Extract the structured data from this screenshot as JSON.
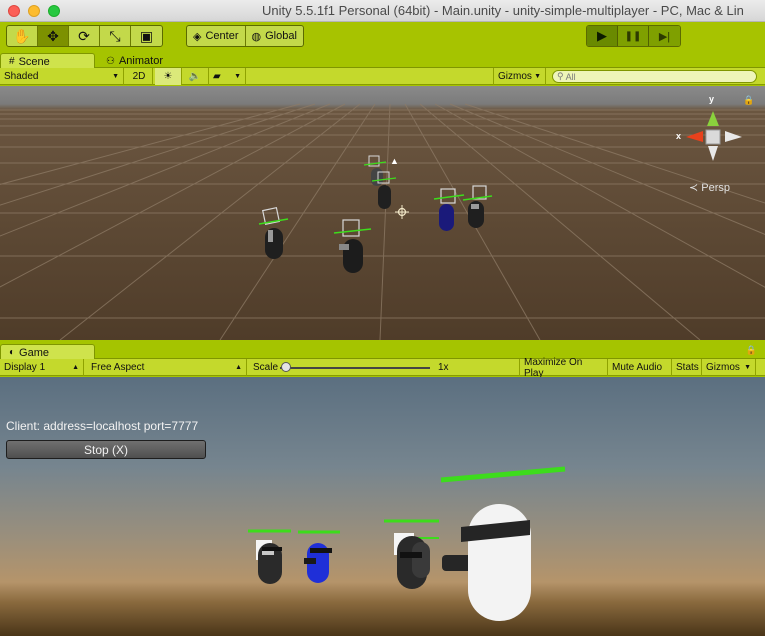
{
  "window": {
    "title": "Unity 5.5.1f1 Personal (64bit) - Main.unity - unity-simple-multiplayer - PC, Mac & Lin"
  },
  "toolbar": {
    "tools": [
      {
        "name": "hand-tool",
        "icon": "hand-icon",
        "glyph": "✋",
        "active": false
      },
      {
        "name": "move-tool",
        "icon": "move-icon",
        "glyph": "✥",
        "active": true
      },
      {
        "name": "rotate-tool",
        "icon": "rotate-icon",
        "glyph": "⟳",
        "active": false
      },
      {
        "name": "scale-tool",
        "icon": "scale-icon",
        "glyph": "⤡",
        "active": false
      },
      {
        "name": "rect-tool",
        "icon": "rect-icon",
        "glyph": "▣",
        "active": false
      }
    ],
    "pivot_label": "Center",
    "pivot_icon_glyph": "◈",
    "space_label": "Global",
    "space_icon_glyph": "◍",
    "play_glyph": "▶",
    "pause_glyph": "❚❚",
    "step_glyph": "▶|"
  },
  "scene_panel": {
    "tabs": [
      {
        "label": "Scene",
        "icon_glyph": "#",
        "active": true
      },
      {
        "label": "Animator",
        "icon_glyph": "⚇",
        "active": false
      }
    ],
    "shading_mode": "Shaded",
    "mode_2d": "2D",
    "lighting_glyph": "☀",
    "audio_glyph": "🔈",
    "effects_glyph": "▰",
    "gizmos_label": "Gizmos",
    "search_placeholder": "All",
    "search_glyph": "⚲",
    "persp_label": "Persp",
    "axis_y": "y",
    "axis_x": "x"
  },
  "game_panel": {
    "tab": {
      "label": "Game",
      "icon_glyph": "◐"
    },
    "display": "Display 1",
    "aspect": "Free Aspect",
    "scale_label": "Scale",
    "scale_value": "1x",
    "scale_fraction": 0.0,
    "maximize_on_play": "Maximize On Play",
    "mute_audio": "Mute Audio",
    "stats": "Stats",
    "gizmos_label": "Gizmos",
    "client_info": "Client: address=localhost port=7777",
    "stop_button": "Stop (X)"
  },
  "colors": {
    "editor_tint": "#a5c400",
    "health_bar": "#3ddc1c",
    "player_local": "#f3f3f3",
    "player_remote": "#2b2b2b",
    "player_blue": "#1f2fd8",
    "gizmo_x": "#e8411c",
    "gizmo_y": "#8ad13d"
  }
}
